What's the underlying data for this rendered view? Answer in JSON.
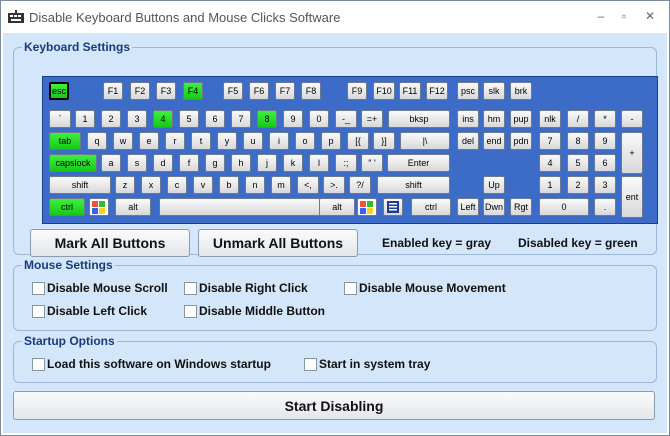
{
  "window": {
    "title": "Disable Keyboard Buttons and Mouse Clicks Software",
    "minimize": "–",
    "maximize": "▫",
    "close": "✕"
  },
  "keyboard_group": {
    "title": "Keyboard Settings",
    "keys": {
      "esc": "esc",
      "f1": "F1",
      "f2": "F2",
      "f3": "F3",
      "f4": "F4",
      "f5": "F5",
      "f6": "F6",
      "f7": "F7",
      "f8": "F8",
      "f9": "F9",
      "f10": "F10",
      "f11": "F11",
      "f12": "F12",
      "psc": "psc",
      "slk": "slk",
      "brk": "brk",
      "tilde": "`",
      "d1": "1",
      "d2": "2",
      "d3": "3",
      "d4": "4",
      "d5": "5",
      "d6": "6",
      "d7": "7",
      "d8": "8",
      "d9": "9",
      "d0": "0",
      "minus": "-_",
      "equals": "=+",
      "bksp": "bksp",
      "ins": "ins",
      "hm": "hm",
      "pup": "pup",
      "nlk": "nlk",
      "npdiv": "/",
      "npmul": "*",
      "npsub": "-",
      "tab": "tab",
      "q": "q",
      "w": "w",
      "e": "e",
      "r": "r",
      "t": "t",
      "y": "y",
      "u": "u",
      "i": "i",
      "o": "o",
      "p": "p",
      "lbr": "[{",
      "rbr": "}]",
      "bslash": "|\\",
      "del": "del",
      "end": "end",
      "pdn": "pdn",
      "np7": "7",
      "np8": "8",
      "np9": "9",
      "npadd": "+",
      "caps": "capslock",
      "a": "a",
      "s": "s",
      "d": "d",
      "f": "f",
      "g": "g",
      "h": "h",
      "j": "j",
      "k": "k",
      "l": "l",
      "semi": ":;",
      "quote": "\" '",
      "enter": "Enter",
      "np4": "4",
      "np5": "5",
      "np6": "6",
      "lshift": "shift",
      "z": "z",
      "x": "x",
      "c": "c",
      "v": "v",
      "b": "b",
      "n": "n",
      "m": "m",
      "comma": "<,",
      "period": ">.",
      "slash": "?/",
      "rshift": "shift",
      "up": "Up",
      "np1": "1",
      "np2": "2",
      "np3": "3",
      "npent": "ent",
      "lctrl": "ctrl",
      "lalt": "alt",
      "space": "",
      "ralt": "alt",
      "rctrl": "ctrl",
      "left": "Left",
      "down": "Dwn",
      "right": "Rgt",
      "np0": "0",
      "npdot": "."
    },
    "disabled_keys": [
      "esc",
      "f4",
      "d4",
      "d8",
      "tab",
      "caps",
      "lctrl"
    ],
    "mark_all": "Mark All Buttons",
    "unmark_all": "Unmark All Buttons",
    "legend_enabled": "Enabled key = gray",
    "legend_disabled": "Disabled key = green"
  },
  "mouse_group": {
    "title": "Mouse Settings",
    "options": [
      "Disable Mouse Scroll",
      "Disable Right Click",
      "Disable Mouse Movement",
      "Disable Left Click",
      "Disable Middle Button"
    ]
  },
  "startup_group": {
    "title": "Startup Options",
    "options": [
      "Load this software on Windows startup",
      "Start in system tray"
    ]
  },
  "start_button": "Start Disabling",
  "colors": {
    "client_bg": "#d4e6fa",
    "keyboard_bg": "#3d6bc8",
    "disabled_key": "#22d422",
    "group_title": "#1b3a7a"
  }
}
